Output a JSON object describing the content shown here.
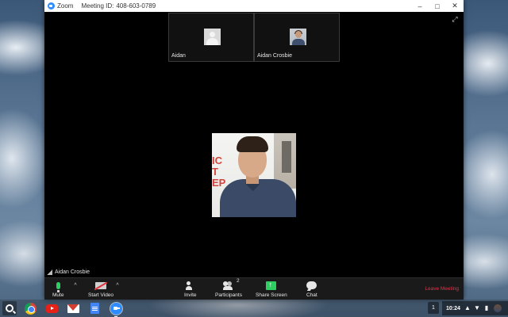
{
  "window": {
    "app_name": "Zoom",
    "meeting_id_label": "Meeting ID:",
    "meeting_id": "408-603-0789",
    "controls": {
      "minimize": "–",
      "maximize": "□",
      "close": "✕"
    },
    "fullscreen_glyph": "⤢"
  },
  "thumbnails": [
    {
      "name": "Aidan",
      "avatar": "default-avatar-icon"
    },
    {
      "name": "Aidan Crosbie",
      "avatar": "profile-photo"
    }
  ],
  "main_video": {
    "speaker_name": "Aidan Crosbie",
    "sign_text": "IC\nT\nEP"
  },
  "toolbar": {
    "mute_label": "Mute",
    "start_video_label": "Start Video",
    "caret": "^",
    "invite_label": "Invite",
    "participants_label": "Participants",
    "participants_count": "2",
    "share_screen_label": "Share Screen",
    "chat_label": "Chat",
    "leave_label": "Leave Meeting"
  },
  "shelf": {
    "notification_count": "1",
    "time": "10:24"
  },
  "colors": {
    "zoom_blue": "#2d8cff",
    "active_green": "#2fce63",
    "leave_red": "#e0344a"
  }
}
